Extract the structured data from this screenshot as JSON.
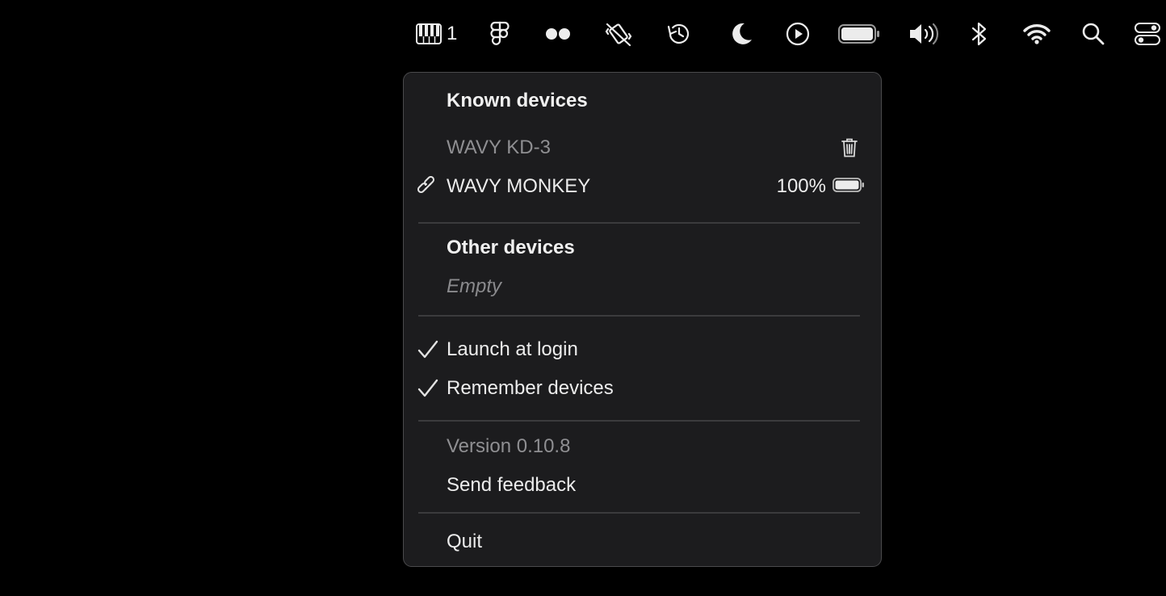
{
  "menubar": {
    "piano_count": "1",
    "icons": [
      "piano-keys-icon",
      "figma-icon",
      "flickr-dots-icon",
      "no-vibration-icon",
      "time-machine-icon",
      "moon-icon",
      "play-circle-icon",
      "battery-icon",
      "volume-icon",
      "bluetooth-icon",
      "wifi-icon",
      "search-icon",
      "control-center-icon"
    ]
  },
  "menu": {
    "known_header": "Known devices",
    "known_devices": [
      {
        "name": "WAVY KD-3",
        "connected": false
      },
      {
        "name": "WAVY MONKEY",
        "connected": true,
        "battery": "100%"
      }
    ],
    "other_header": "Other devices",
    "other_empty": "Empty",
    "launch_at_login": "Launch at login",
    "remember_devices": "Remember devices",
    "version": "Version 0.10.8",
    "send_feedback": "Send feedback",
    "quit": "Quit"
  }
}
